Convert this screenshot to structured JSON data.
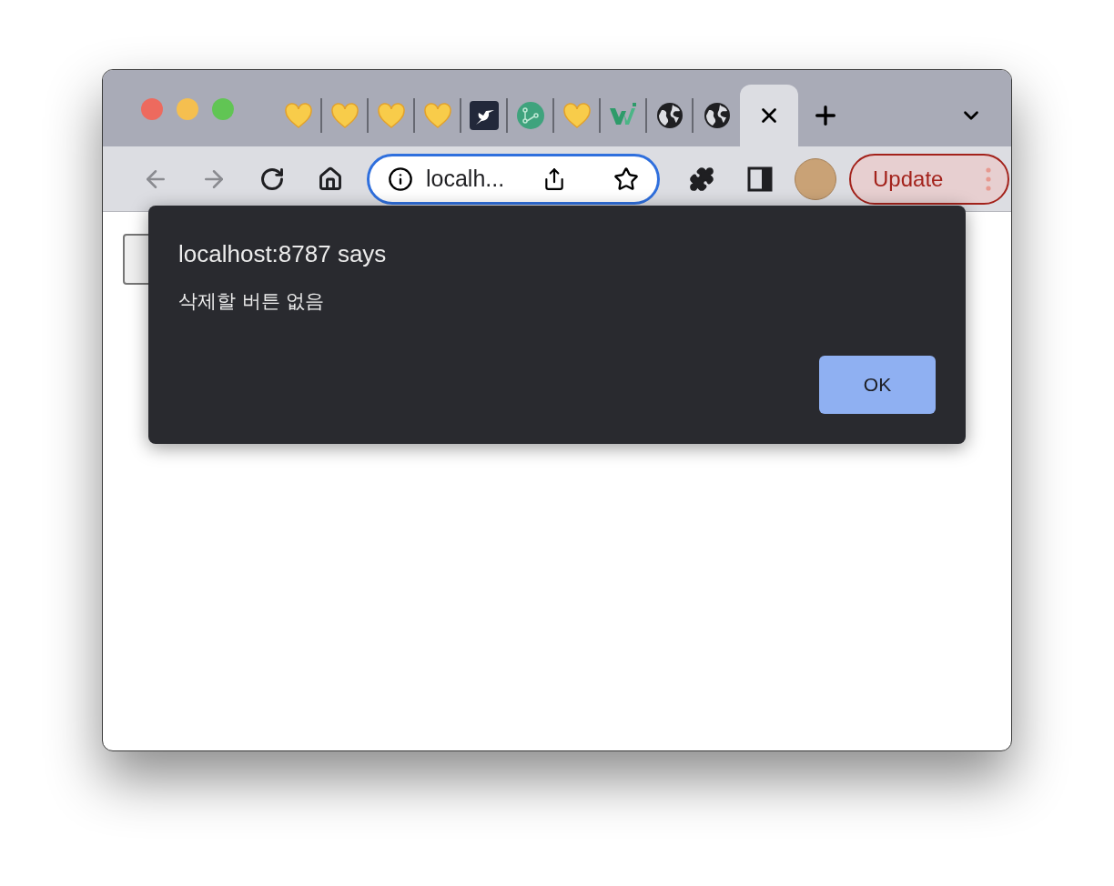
{
  "window": {
    "controls": [
      {
        "color": "#ed6a5e"
      },
      {
        "color": "#f5bf4f"
      },
      {
        "color": "#61c554"
      }
    ]
  },
  "tabs": [
    {
      "kind": "heart",
      "selected": false
    },
    {
      "kind": "heart",
      "selected": false
    },
    {
      "kind": "heart",
      "selected": false
    },
    {
      "kind": "heart",
      "selected": false
    },
    {
      "kind": "bird",
      "selected": false
    },
    {
      "kind": "nodes",
      "selected": false
    },
    {
      "kind": "heart",
      "selected": false
    },
    {
      "kind": "w3",
      "selected": false
    },
    {
      "kind": "globe",
      "selected": false
    },
    {
      "kind": "globe",
      "selected": false
    },
    {
      "selected": true
    }
  ],
  "toolbar": {
    "nav": [
      {
        "kind": "back",
        "disabled": true
      },
      {
        "kind": "forward",
        "disabled": true
      },
      {
        "kind": "reload",
        "disabled": false
      },
      {
        "kind": "home",
        "disabled": false
      }
    ],
    "address": {
      "value": "localh..."
    },
    "update_button": "Update"
  },
  "dialog": {
    "title": "localhost:8787 says",
    "message": "삭제할 버튼 없음",
    "button": "OK"
  }
}
